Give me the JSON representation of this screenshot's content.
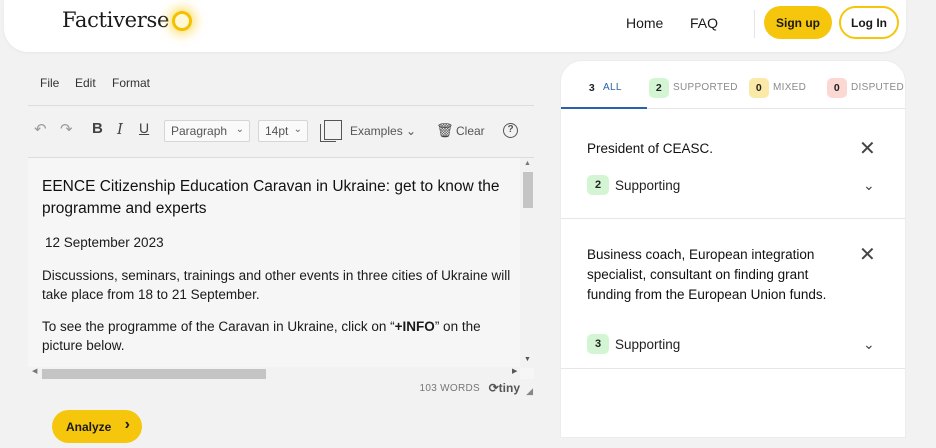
{
  "header": {
    "logo": "Factiverse",
    "nav": {
      "home": "Home",
      "faq": "FAQ"
    },
    "signup": "Sign up",
    "login": "Log In"
  },
  "editor": {
    "menu": {
      "file": "File",
      "edit": "Edit",
      "format": "Format"
    },
    "toolbar": {
      "bold": "B",
      "italic": "I",
      "underline": "U",
      "paragraph": "Paragraph",
      "font_size": "14pt",
      "examples": "Examples",
      "clear": "Clear",
      "help": "?"
    },
    "content": {
      "title": "EENCE Citizenship Education Caravan in Ukraine: get to know the programme and experts",
      "date": "12 September 2023",
      "p1": "Discussions, seminars, trainings and other events in three cities of Ukraine will take place from 18 to 21 September.",
      "p2_before": "To see the programme of the Caravan in Ukraine, click on “",
      "p2_bold": "+INFO",
      "p2_after": "” on the picture below."
    },
    "word_count": "103 WORDS",
    "brand": "tiny"
  },
  "analyze_label": "Analyze",
  "panel": {
    "tabs": [
      {
        "count": "3",
        "label": "ALL"
      },
      {
        "count": "2",
        "label": "SUPPORTED"
      },
      {
        "count": "0",
        "label": "MIXED"
      },
      {
        "count": "0",
        "label": "DISPUTED"
      }
    ],
    "claims": [
      {
        "text": "President of CEASC.",
        "support_count": "2",
        "support_label": "Supporting"
      },
      {
        "text": "Business coach, European integration specialist, consultant on finding grant funding from the European Union funds.",
        "support_count": "3",
        "support_label": "Supporting"
      }
    ]
  },
  "colors": {
    "accent": "#f6c60d",
    "tab_active": "#2962a8",
    "supported": "#d4f5d4",
    "mixed": "#fbe9a8",
    "disputed": "#fbd9d2"
  },
  "icons": [
    "sun-icon",
    "undo-icon",
    "redo-icon",
    "examples-icon",
    "trash-icon",
    "help-icon",
    "close-icon",
    "chevron-down-icon",
    "chevron-right-icon"
  ]
}
